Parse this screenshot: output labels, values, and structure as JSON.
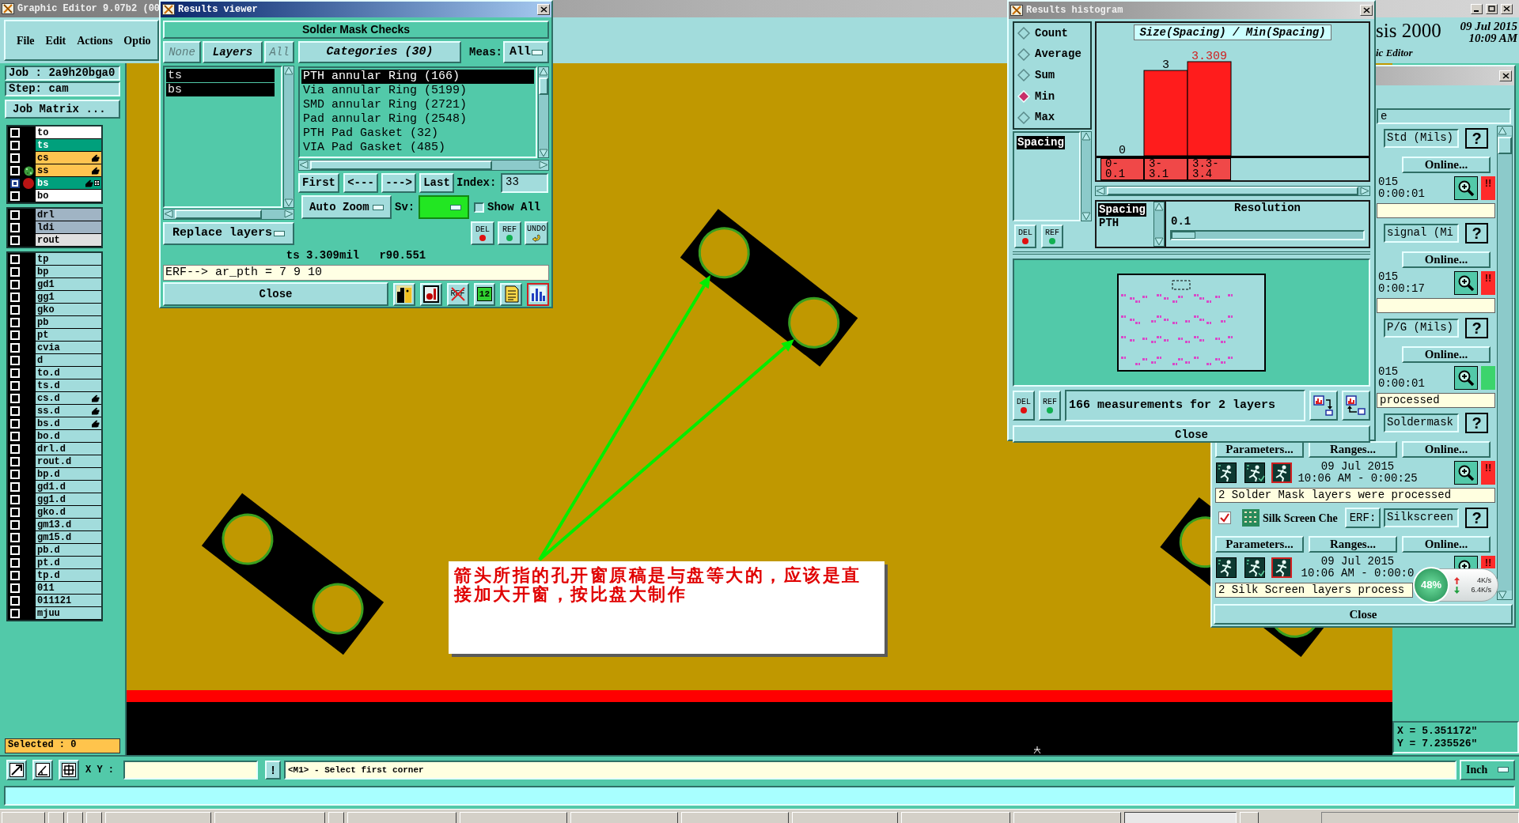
{
  "main_window": {
    "title": "Graphic Editor 9.07b2 (00",
    "menu": [
      "File",
      "Edit",
      "Actions",
      "Optio"
    ],
    "brand": "sis 2000",
    "subtitle": "ic Editor",
    "date": "09 Jul 2015",
    "time": "10:09 AM"
  },
  "job_panel": {
    "job": "Job : 2a9h20bga0",
    "step": "Step: cam",
    "matrix_button": "Job Matrix ...",
    "layer_groups": [
      [
        {
          "name": "to",
          "color": "#ffffff",
          "hand": false,
          "displayed": false,
          "work": false,
          "grid": false,
          "selected": false
        },
        {
          "name": "ts",
          "color": "#00a07c",
          "hand": false,
          "displayed": false,
          "work": false,
          "grid": false,
          "selected": false
        },
        {
          "name": "cs",
          "color": "#ffc450",
          "hand": true,
          "displayed": false,
          "work": false,
          "grid": false,
          "selected": false
        },
        {
          "name": "ss",
          "color": "#ffc450",
          "hand": true,
          "displayed": true,
          "work": false,
          "grid": false,
          "selected": false
        },
        {
          "name": "bs",
          "color": "#00a07c",
          "hand": true,
          "displayed": false,
          "work": true,
          "grid": true,
          "selected": true
        },
        {
          "name": "bo",
          "color": "#ffffff",
          "hand": false,
          "displayed": false,
          "work": false,
          "grid": false,
          "selected": false
        }
      ],
      [
        {
          "name": "drl",
          "color": "#a0b4c4",
          "hand": false,
          "displayed": false,
          "work": false,
          "grid": false,
          "selected": false
        },
        {
          "name": "ldi",
          "color": "#a0b4c4",
          "hand": false,
          "displayed": false,
          "work": false,
          "grid": false,
          "selected": false
        },
        {
          "name": "rout",
          "color": "#e0e0e0",
          "hand": false,
          "displayed": false,
          "work": false,
          "grid": false,
          "selected": false
        }
      ],
      [
        {
          "name": "tp",
          "color": "#a2dcdc",
          "hand": false,
          "displayed": false,
          "work": false,
          "grid": false,
          "selected": false
        },
        {
          "name": "bp",
          "color": "#a2dcdc",
          "hand": false,
          "displayed": false,
          "work": false,
          "grid": false,
          "selected": false
        },
        {
          "name": "gd1",
          "color": "#a2dcdc",
          "hand": false,
          "displayed": false,
          "work": false,
          "grid": false,
          "selected": false
        },
        {
          "name": "gg1",
          "color": "#a2dcdc",
          "hand": false,
          "displayed": false,
          "work": false,
          "grid": false,
          "selected": false
        },
        {
          "name": "gko",
          "color": "#a2dcdc",
          "hand": false,
          "displayed": false,
          "work": false,
          "grid": false,
          "selected": false
        },
        {
          "name": "pb",
          "color": "#a2dcdc",
          "hand": false,
          "displayed": false,
          "work": false,
          "grid": false,
          "selected": false
        },
        {
          "name": "pt",
          "color": "#a2dcdc",
          "hand": false,
          "displayed": false,
          "work": false,
          "grid": false,
          "selected": false
        },
        {
          "name": "cvia",
          "color": "#a2dcdc",
          "hand": false,
          "displayed": false,
          "work": false,
          "grid": false,
          "selected": false
        },
        {
          "name": "d",
          "color": "#a2dcdc",
          "hand": false,
          "displayed": false,
          "work": false,
          "grid": false,
          "selected": false
        },
        {
          "name": "to.d",
          "color": "#a2dcdc",
          "hand": false,
          "displayed": false,
          "work": false,
          "grid": false,
          "selected": false
        },
        {
          "name": "ts.d",
          "color": "#a2dcdc",
          "hand": false,
          "displayed": false,
          "work": false,
          "grid": false,
          "selected": false
        },
        {
          "name": "cs.d",
          "color": "#a2dcdc",
          "hand": true,
          "displayed": false,
          "work": false,
          "grid": false,
          "selected": false
        },
        {
          "name": "ss.d",
          "color": "#a2dcdc",
          "hand": true,
          "displayed": false,
          "work": false,
          "grid": false,
          "selected": false
        },
        {
          "name": "bs.d",
          "color": "#a2dcdc",
          "hand": true,
          "displayed": false,
          "work": false,
          "grid": false,
          "selected": false
        },
        {
          "name": "bo.d",
          "color": "#a2dcdc",
          "hand": false,
          "displayed": false,
          "work": false,
          "grid": false,
          "selected": false
        },
        {
          "name": "drl.d",
          "color": "#a2dcdc",
          "hand": false,
          "displayed": false,
          "work": false,
          "grid": false,
          "selected": false
        },
        {
          "name": "rout.d",
          "color": "#a2dcdc",
          "hand": false,
          "displayed": false,
          "work": false,
          "grid": false,
          "selected": false
        },
        {
          "name": "bp.d",
          "color": "#a2dcdc",
          "hand": false,
          "displayed": false,
          "work": false,
          "grid": false,
          "selected": false
        },
        {
          "name": "gd1.d",
          "color": "#a2dcdc",
          "hand": false,
          "displayed": false,
          "work": false,
          "grid": false,
          "selected": false
        },
        {
          "name": "gg1.d",
          "color": "#a2dcdc",
          "hand": false,
          "displayed": false,
          "work": false,
          "grid": false,
          "selected": false
        },
        {
          "name": "gko.d",
          "color": "#a2dcdc",
          "hand": false,
          "displayed": false,
          "work": false,
          "grid": false,
          "selected": false
        },
        {
          "name": "gm13.d",
          "color": "#a2dcdc",
          "hand": false,
          "displayed": false,
          "work": false,
          "grid": false,
          "selected": false
        },
        {
          "name": "gm15.d",
          "color": "#a2dcdc",
          "hand": false,
          "displayed": false,
          "work": false,
          "grid": false,
          "selected": false
        },
        {
          "name": "pb.d",
          "color": "#a2dcdc",
          "hand": false,
          "displayed": false,
          "work": false,
          "grid": false,
          "selected": false
        },
        {
          "name": "pt.d",
          "color": "#a2dcdc",
          "hand": false,
          "displayed": false,
          "work": false,
          "grid": false,
          "selected": false
        },
        {
          "name": "tp.d",
          "color": "#a2dcdc",
          "hand": false,
          "displayed": false,
          "work": false,
          "grid": false,
          "selected": false
        },
        {
          "name": "011",
          "color": "#a2dcdc",
          "hand": false,
          "displayed": false,
          "work": false,
          "grid": false,
          "selected": false
        },
        {
          "name": "011121",
          "color": "#a2dcdc",
          "hand": false,
          "displayed": false,
          "work": false,
          "grid": false,
          "selected": false
        },
        {
          "name": "mjuu",
          "color": "#a2dcdc",
          "hand": false,
          "displayed": false,
          "work": false,
          "grid": false,
          "selected": false
        }
      ]
    ],
    "selected_count": "Selected : 0"
  },
  "canvas": {
    "note": "箭头所指的孔开窗原稿是与盘等大的，应该是直接加大开窗，按比盘大制作"
  },
  "coordinates": {
    "x": "X = 5.351172\"",
    "y": "Y = 7.235526\""
  },
  "command_bar": {
    "xy_label": "X Y :",
    "alert_button": "!",
    "message": "<M1> - Select first corner",
    "units": "Inch"
  },
  "results_viewer": {
    "title": "Results viewer",
    "header": "Solder Mask Checks",
    "layer_buttons": [
      {
        "label": "None",
        "disabled": true
      },
      {
        "label": "Layers",
        "disabled": false
      },
      {
        "label": "All",
        "disabled": true
      }
    ],
    "layers": [
      {
        "label": "ts",
        "selected": true
      },
      {
        "label": "bs",
        "selected": true
      }
    ],
    "layer_action": "Replace layers",
    "categories_button": "Categories (30)",
    "meas_label": "Meas:",
    "meas_value": "All",
    "categories": [
      {
        "label": "PTH annular Ring (166)",
        "selected": true
      },
      {
        "label": "Via annular Ring (5199)",
        "selected": false
      },
      {
        "label": "SMD annular Ring (2721)",
        "selected": false
      },
      {
        "label": "Pad annular Ring (2548)",
        "selected": false
      },
      {
        "label": "PTH Pad Gasket (32)",
        "selected": false
      },
      {
        "label": "VIA Pad Gasket (485)",
        "selected": false
      }
    ],
    "nav_buttons": [
      "First",
      "<---",
      "--->",
      "Last"
    ],
    "index_label": "Index:",
    "index_value": "33",
    "zoom_mode": "Auto Zoom",
    "sv_label": "Sv:",
    "show_all": {
      "label": "Show All",
      "checked": false
    },
    "tools": [
      {
        "label": "DEL",
        "kind": "delete"
      },
      {
        "label": "REF",
        "kind": "refresh"
      },
      {
        "label": "UNDO",
        "kind": "undo"
      }
    ],
    "status": "ts 3.309mil   r90.551",
    "erf": "ERF--> ar_pth = 7 9 10",
    "close": "Close",
    "icons": [
      {
        "kind": "layers",
        "selected": false
      },
      {
        "kind": "record",
        "selected": false
      },
      {
        "kind": "clear",
        "label": "REF",
        "selected": false
      },
      {
        "kind": "counter",
        "label": "12",
        "selected": false
      },
      {
        "kind": "report",
        "selected": false
      },
      {
        "kind": "histogram",
        "selected": true
      }
    ]
  },
  "results_histogram": {
    "title": "Results histogram",
    "modes": [
      {
        "label": "Count",
        "selected": false
      },
      {
        "label": "Average",
        "selected": false
      },
      {
        "label": "Sum",
        "selected": false
      },
      {
        "label": "Min",
        "selected": true
      },
      {
        "label": "Max",
        "selected": false
      }
    ],
    "attributes": [
      {
        "label": "Spacing",
        "selected": true
      }
    ],
    "tools": [
      {
        "label": "DEL",
        "kind": "delete"
      },
      {
        "label": "REF",
        "kind": "refresh"
      }
    ],
    "chart_data": {
      "type": "bar",
      "title": "Size(Spacing) / Min(Spacing)",
      "categories": [
        "0-0.1",
        "3-3.1",
        "3.3-3.4"
      ],
      "series": [
        {
          "color": "#ff1c1c",
          "values": [
            0,
            3,
            3.309
          ]
        }
      ],
      "data_labels": true
    },
    "sub_attributes": [
      {
        "label": "Spacing",
        "selected": true
      },
      {
        "label": "PTH",
        "selected": false
      }
    ],
    "resolution": {
      "label": "Resolution",
      "value": "0.1",
      "level": 0
    },
    "bottom_tools": [
      {
        "label": "DEL",
        "kind": "delete"
      },
      {
        "label": "REF",
        "kind": "refresh"
      }
    ],
    "summary": "166 measurements for 2 layers",
    "close": "Close"
  },
  "checks_window": {
    "title_field": "e",
    "checks": [
      {
        "kind": "covered",
        "field": "Std (Mils)",
        "help": "?",
        "buttons": [
          "Online..."
        ],
        "date": "015",
        "time": "0:00:01",
        "color": "#ff2a2a",
        "mark": "!!"
      },
      {
        "kind": "covered",
        "field": "signal (Mi",
        "help": "?",
        "buttons": [
          "Online..."
        ],
        "date": "015",
        "time": "0:00:17",
        "color": "#ff2a2a",
        "mark": "!!"
      },
      {
        "kind": "covered",
        "field": "P/G (Mils)",
        "help": "?",
        "buttons": [
          "Online..."
        ],
        "date": "015",
        "time": "0:00:01",
        "color": "#3cd46c",
        "message": "processed"
      },
      {
        "kind": "partial",
        "field": "Soldermask",
        "help": "?",
        "buttons": [
          "Parameters...",
          "Ranges...",
          "Online..."
        ],
        "date": "09 Jul 2015",
        "time": "10:06 AM - 0:00:25",
        "color": "#ff2a2a",
        "mark": "!!",
        "message": "2 Solder Mask layers were processed"
      },
      {
        "kind": "open",
        "checked": true,
        "name": "Silk Screen Che",
        "erf": "ERF:",
        "field": "Silkscreen",
        "help": "?",
        "buttons": [
          "Parameters...",
          "Ranges...",
          "Online..."
        ],
        "date": "09 Jul 2015",
        "time": "10:06 AM - 0:00:0",
        "color": "#ff2a2a",
        "mark": "!!",
        "message": "2 Silk Screen layers process"
      }
    ],
    "close": "Close"
  },
  "speed_widget": {
    "percent": "48%",
    "upload": "4K/s",
    "download": "6.4K/s"
  },
  "taskbar": {
    "buttons": [
      {
        "selected": false
      },
      {
        "selected": false
      },
      {
        "selected": false
      },
      {
        "selected": false
      },
      {
        "selected": false
      },
      {
        "selected": false
      },
      {
        "selected": false
      },
      {
        "selected": false
      },
      {
        "selected": false
      },
      {
        "selected": false
      },
      {
        "selected": false
      },
      {
        "selected": false
      },
      {
        "selected": false
      },
      {
        "selected": false
      },
      {
        "selected": true
      },
      {
        "selected": false
      }
    ]
  }
}
